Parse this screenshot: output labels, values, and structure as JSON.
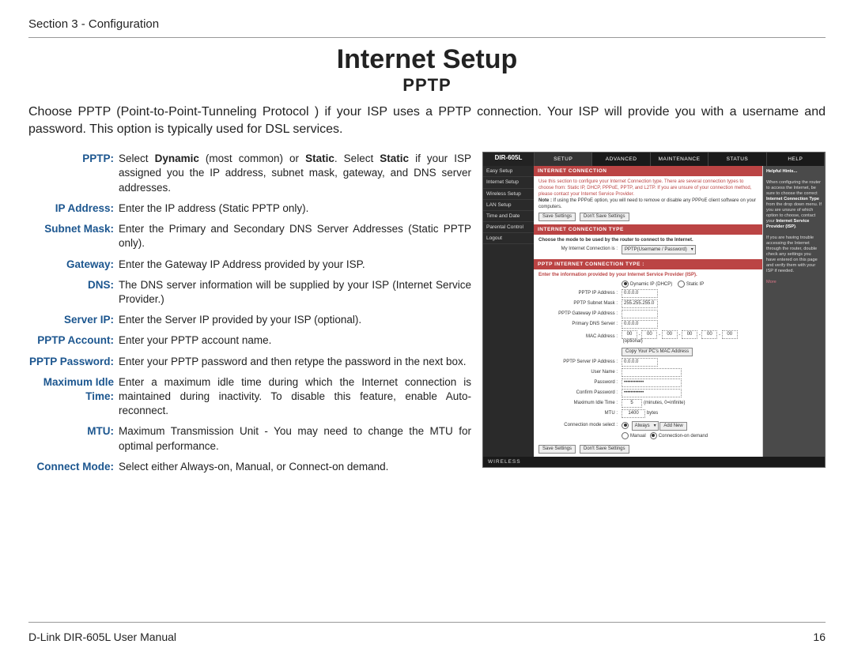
{
  "header": {
    "section": "Section 3 - Configuration"
  },
  "title": "Internet Setup",
  "subtitle": "PPTP",
  "intro": "Choose PPTP (Point-to-Point-Tunneling Protocol ) if your ISP uses a PPTP connection. Your ISP will provide you with a username and password. This option is typically used for DSL services.",
  "defs": [
    {
      "term": "PPTP:",
      "desc_html": "Select <b>Dynamic</b> (most common) or <b>Static</b>. Select <b>Static</b> if your ISP assigned you the IP address, subnet mask, gateway, and DNS server addresses."
    },
    {
      "term": "IP Address:",
      "desc_html": "Enter the IP address (Static PPTP only)."
    },
    {
      "term": "Subnet Mask:",
      "desc_html": "Enter the Primary and Secondary DNS Server Addresses (Static PPTP only)."
    },
    {
      "term": "Gateway:",
      "desc_html": "Enter the Gateway IP Address provided by your ISP."
    },
    {
      "term": "DNS:",
      "desc_html": "The DNS server information will be supplied by your ISP (Internet Service Provider.)"
    },
    {
      "term": "Server IP:",
      "desc_html": "Enter the Server IP provided by your ISP (optional)."
    },
    {
      "term": "PPTP Account:",
      "desc_html": "Enter your PPTP account name."
    },
    {
      "term": "PPTP Password:",
      "desc_html": "Enter your PPTP password and then retype the password in the next box."
    },
    {
      "term": "Maximum Idle Time:",
      "desc_html": "Enter a maximum idle time during which the Internet connection is maintained during inactivity. To disable this feature, enable Auto-reconnect."
    },
    {
      "term": "MTU:",
      "desc_html": "Maximum Transmission Unit - You may need to change the MTU for optimal performance."
    },
    {
      "term": "Connect Mode:",
      "desc_html": "Select either Always-on, Manual, or Connect-on demand."
    }
  ],
  "screenshot": {
    "brand": "DIR-605L",
    "tabs": [
      "SETUP",
      "ADVANCED",
      "MAINTENANCE",
      "STATUS",
      "HELP"
    ],
    "active_tab": 0,
    "side": [
      "Easy Setup",
      "Internet Setup",
      "Wireless Setup",
      "LAN Setup",
      "Time and Date",
      "Parental Control",
      "Logout"
    ],
    "sec1_title": "INTERNET CONNECTION",
    "sec1_note": "Use this section to configure your Internet Connection type. There are several connection types to choose from: Static IP, DHCP, PPPoE, PPTP, and L2TP. If you are unsure of your connection method, please contact your Internet Service Provider.",
    "sec1_note2_label": "Note :",
    "sec1_note2": " If using the PPPoE option, you will need to remove or disable any PPPoE client software on your computers.",
    "btn_save": "Save Settings",
    "btn_dont": "Don't Save Settings",
    "sec2_title": "INTERNET CONNECTION TYPE",
    "sec2_sub": "Choose the mode to be used by the router to connect to the Internet.",
    "sec2_label": "My Internet Connection is :",
    "sec2_select": "PPTP(Username / Password)",
    "sec3_title": "PPTP INTERNET CONNECTION TYPE :",
    "sec3_sub": "Enter the information provided by your Internet Service Provider (ISP).",
    "radio_dyn": "Dynamic IP (DHCP)",
    "radio_stat": "Static IP",
    "rows": {
      "ip": {
        "label": "PPTP IP Address :",
        "val": "0.0.0.0"
      },
      "mask": {
        "label": "PPTP Subnet Mask :",
        "val": "255.255.255.0"
      },
      "gw": {
        "label": "PPTP Gateway IP Address :",
        "val": ""
      },
      "dns": {
        "label": "Primary DNS Server :",
        "val": "0.0.0.0"
      },
      "mac": {
        "label": "MAC Address :",
        "seg": "00",
        "opt": "(optional)"
      },
      "copy": "Copy Your PC's MAC Address",
      "srv": {
        "label": "PPTP Server IP Address :",
        "val": "0.0.0.0"
      },
      "user": {
        "label": "User Name :",
        "val": ""
      },
      "pw": {
        "label": "Password :",
        "val": "••••••••••••"
      },
      "cpw": {
        "label": "Confirm Password :",
        "val": "••••••••••••"
      },
      "idle": {
        "label": "Maximum Idle Time :",
        "val": "5",
        "unit": "(minutes, 0=infinite)"
      },
      "mtu": {
        "label": "MTU :",
        "val": "1400",
        "unit": "bytes"
      },
      "cmode": {
        "label": "Connection mode select :",
        "sel": "Always",
        "btn": "Add New",
        "r1": "Manual",
        "r2": "Connection-on demand"
      }
    },
    "help_title": "Helpful Hints...",
    "help_body1": "When configuring the router to access the Internet, be sure to choose the correct ",
    "help_b1": "Internet Connection Type",
    "help_body2": " from the drop down menu. If you are unsure of which option to choose, contact your ",
    "help_b2": "Internet Service Provider (ISP)",
    "help_body3": ".",
    "help_body4": "If you are having trouble accessing the Internet through the router, double check any settings you have entered on this page and verify them with your ISP if needed.",
    "help_more": "More",
    "footbar": "WIRELESS"
  },
  "footer": {
    "left": "D-Link DIR-605L User Manual",
    "right": "16"
  }
}
